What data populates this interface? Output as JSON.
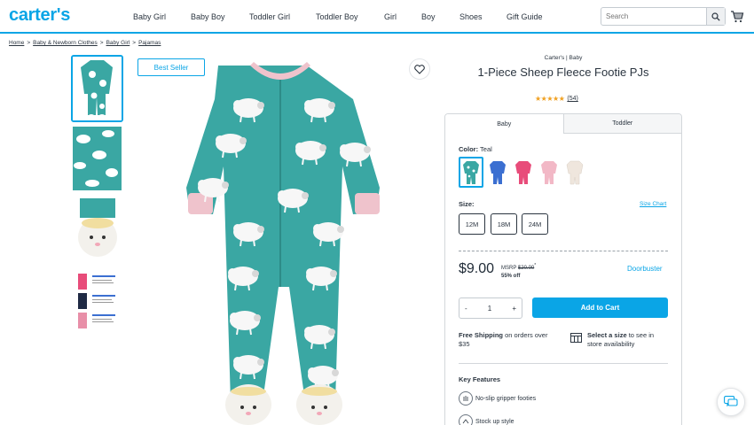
{
  "brand": {
    "logo_text": "carter's",
    "accent": "#0aa5e6"
  },
  "nav": {
    "items": [
      "Baby Girl",
      "Baby Boy",
      "Toddler Girl",
      "Toddler Boy",
      "Girl",
      "Boy",
      "Shoes",
      "Gift Guide"
    ]
  },
  "search": {
    "placeholder": "Search",
    "icon": "search-icon"
  },
  "cart": {
    "icon": "cart-icon"
  },
  "breadcrumb": [
    "Home",
    "Baby & Newborn Clothes",
    "Baby Girl",
    "Pajamas"
  ],
  "product": {
    "badge": "Best Seller",
    "brand_line": "Carter's | Baby",
    "title": "1-Piece Sheep Fleece Footie PJs",
    "stars": "★★★★★",
    "rating_value": 5,
    "review_count": "(54)",
    "tabs": [
      "Baby",
      "Toddler"
    ],
    "color_label": "Color:",
    "color_value": "Teal",
    "swatch_colors": [
      "#3aa7a3",
      "#3b6fd1",
      "#e84c7a",
      "#f2b8c6",
      "#efe6dd"
    ],
    "size_label": "Size:",
    "size_chart": "Size Chart",
    "sizes": [
      "12M",
      "18M",
      "24M"
    ],
    "price": "$9.00",
    "msrp_label": "MSRP",
    "msrp_value": "$20.00",
    "msrp_mark": "*",
    "discount": "55% off",
    "doorbuster": "Doorbuster",
    "qty_minus": "-",
    "qty_value": "1",
    "qty_plus": "+",
    "add_to_cart": "Add to Cart",
    "shipping_bold": "Free Shipping",
    "shipping_rest": " on orders over $35",
    "store_bold": "Select a size",
    "store_rest": " to see in store availability",
    "key_features_title": "Key Features",
    "features": [
      "No-slip gripper footies",
      "Stock up style"
    ]
  }
}
